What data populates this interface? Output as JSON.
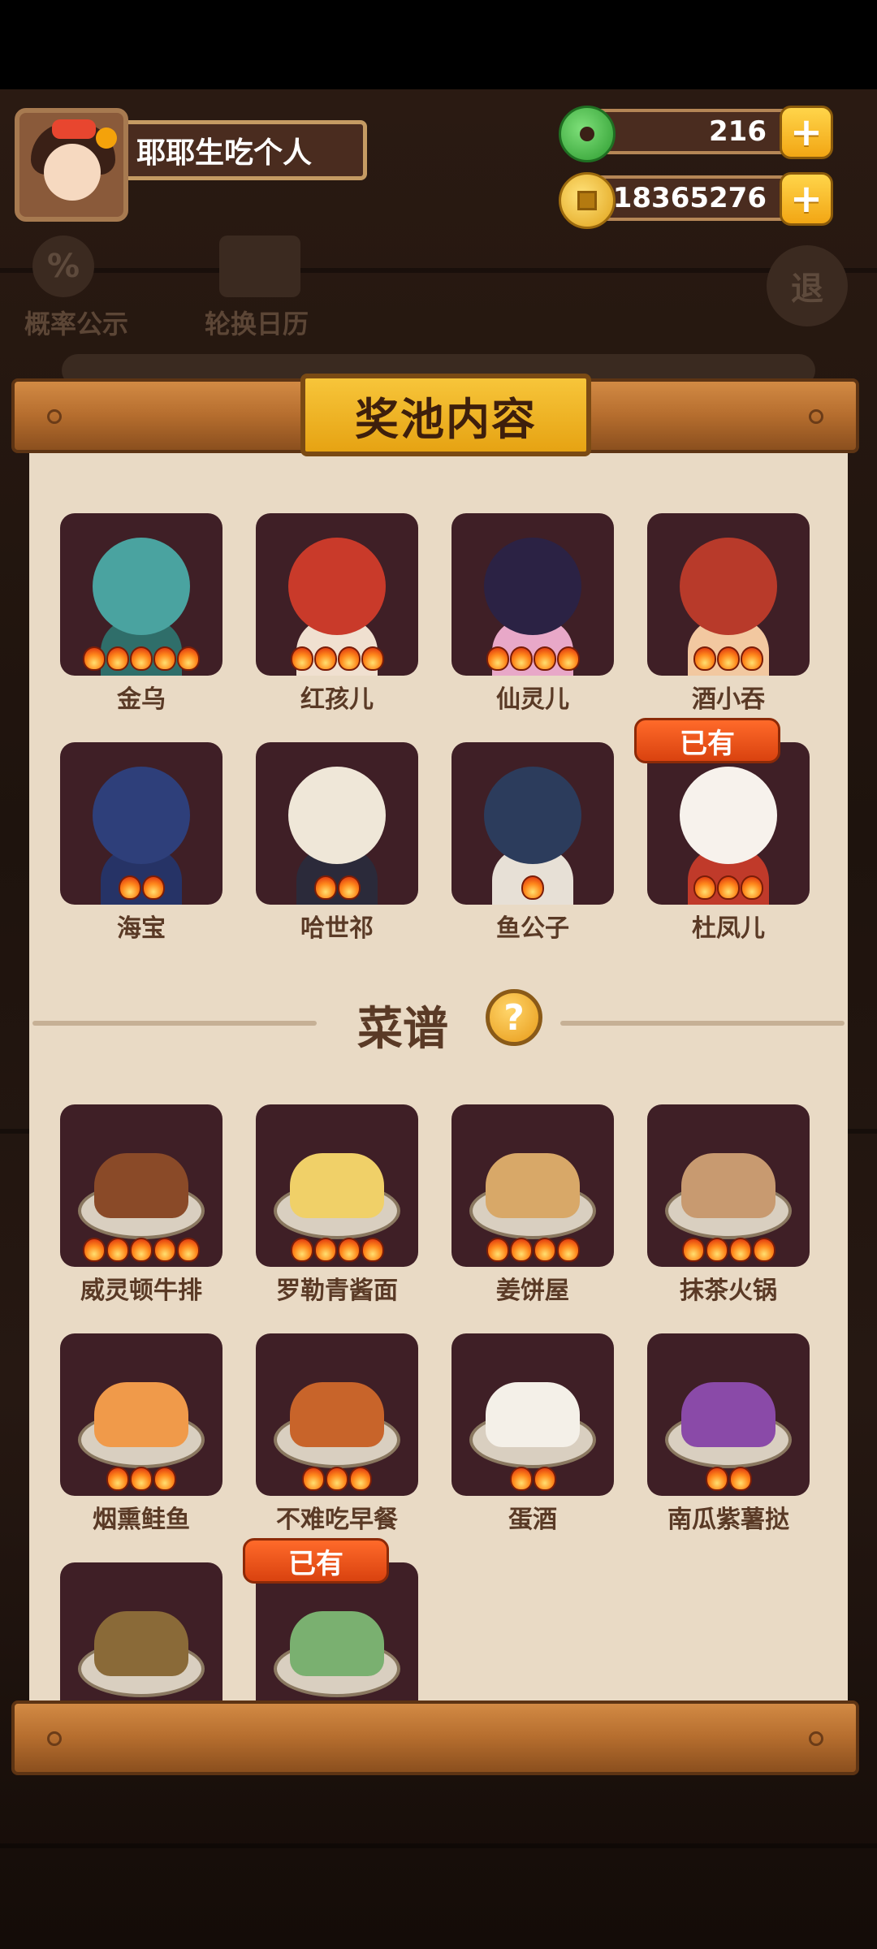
{
  "player": {
    "name": "耶耶生吃个人",
    "jade": "216",
    "coins": "18365276",
    "plus_label": "+"
  },
  "background": {
    "probability_label": "概率公示",
    "probability_icon": "%",
    "calendar_label": "轮换日历",
    "exit_icon": "退"
  },
  "panel": {
    "title": "奖池内容",
    "owned_label": "已有",
    "characters": [
      {
        "name": "金乌",
        "stars": 5,
        "owned": false,
        "head": "#4aa3a0",
        "body": "#2f6e6a"
      },
      {
        "name": "红孩儿",
        "stars": 4,
        "owned": false,
        "head": "#c93a2a",
        "body": "#f0e0d0"
      },
      {
        "name": "仙灵儿",
        "stars": 4,
        "owned": false,
        "head": "#2b2244",
        "body": "#e8a8c8"
      },
      {
        "name": "酒小吞",
        "stars": 3,
        "owned": false,
        "head": "#b83a2a",
        "body": "#f2c8a0"
      },
      {
        "name": "海宝",
        "stars": 2,
        "owned": false,
        "head": "#2e3f7a",
        "body": "#263366"
      },
      {
        "name": "哈世祁",
        "stars": 2,
        "owned": false,
        "head": "#efe7d8",
        "body": "#2b2a3a"
      },
      {
        "name": "鱼公子",
        "stars": 1,
        "owned": false,
        "head": "#2c3c5c",
        "body": "#e7e0d6"
      },
      {
        "name": "杜凤儿",
        "stars": 3,
        "owned": true,
        "head": "#f7f2ec",
        "body": "#c03a2a"
      }
    ],
    "recipe_section": {
      "title": "菜谱",
      "help_icon": "?"
    },
    "recipes": [
      {
        "name": "威灵顿牛排",
        "stars": 5,
        "owned": false,
        "food": "#8a4a28"
      },
      {
        "name": "罗勒青酱面",
        "stars": 4,
        "owned": false,
        "food": "#f0d068"
      },
      {
        "name": "姜饼屋",
        "stars": 4,
        "owned": false,
        "food": "#d8a868"
      },
      {
        "name": "抹茶火锅",
        "stars": 4,
        "owned": false,
        "food": "#c89a70"
      },
      {
        "name": "烟熏鲑鱼",
        "stars": 3,
        "owned": false,
        "food": "#f09a4a"
      },
      {
        "name": "不难吃早餐",
        "stars": 3,
        "owned": false,
        "food": "#c8642a"
      },
      {
        "name": "蛋酒",
        "stars": 2,
        "owned": false,
        "food": "#f4f0e8"
      },
      {
        "name": "南瓜紫薯挞",
        "stars": 2,
        "owned": false,
        "food": "#8a4aa8"
      },
      {
        "name": "",
        "stars": 0,
        "owned": false,
        "food": "#8a6a38"
      },
      {
        "name": "",
        "stars": 0,
        "owned": true,
        "food": "#7ab070"
      }
    ]
  }
}
